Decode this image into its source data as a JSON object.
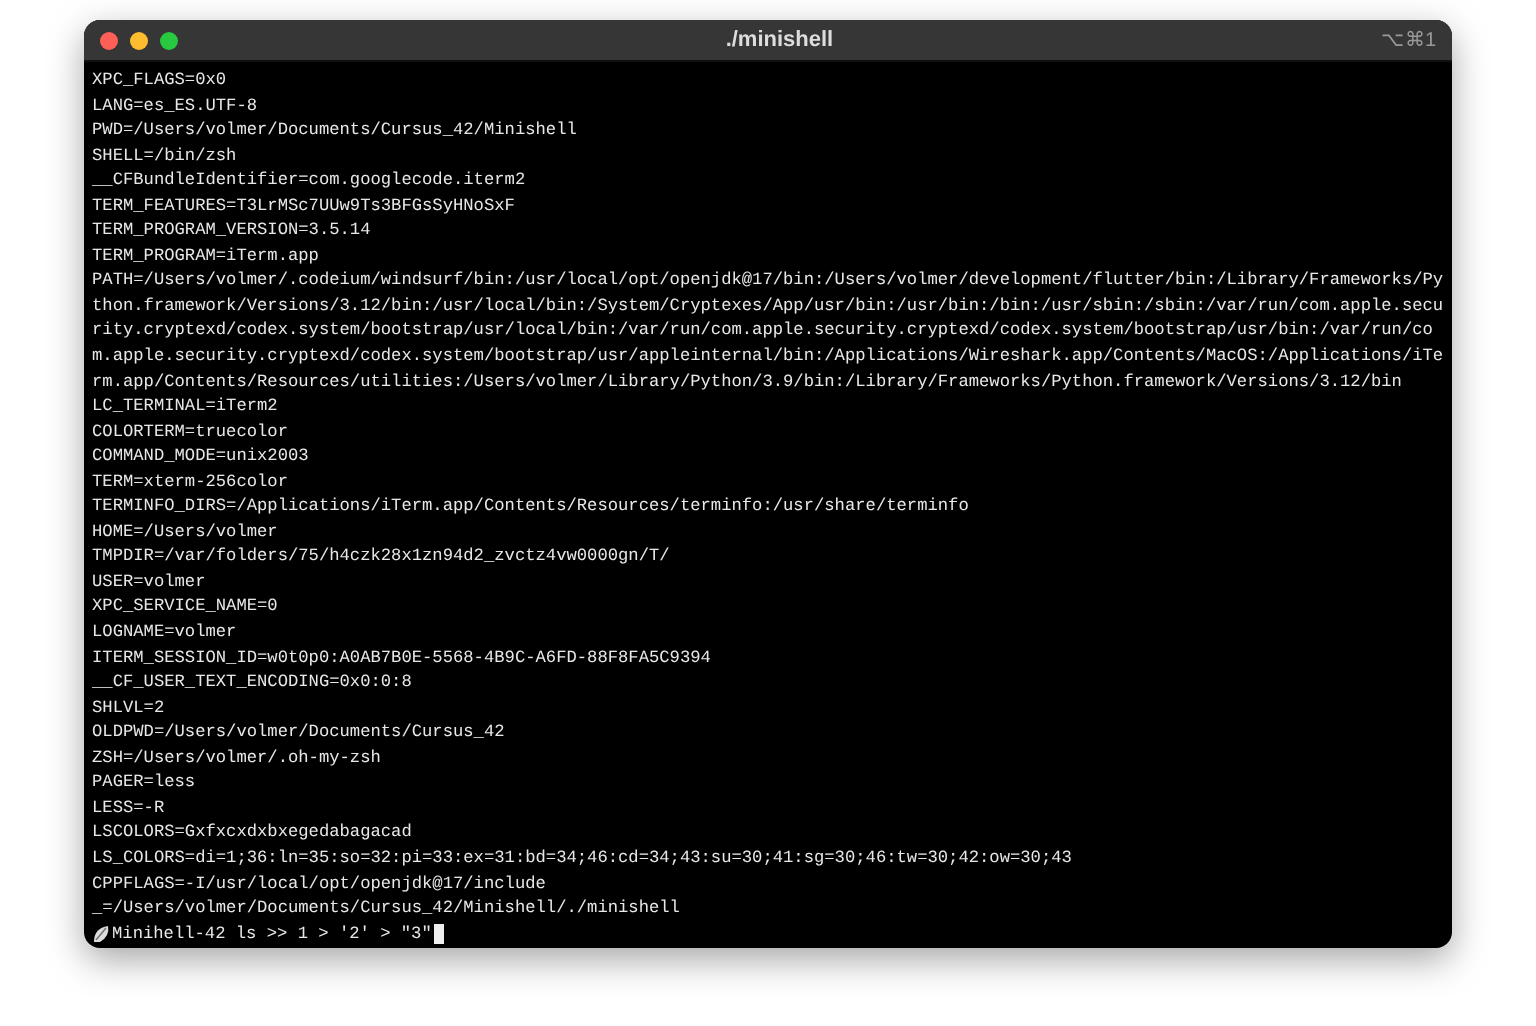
{
  "window": {
    "title": "./minishell",
    "shortcut": "⌥⌘1"
  },
  "terminal": {
    "lines": [
      "XPC_FLAGS=0x0",
      "LANG=es_ES.UTF-8",
      "PWD=/Users/volmer/Documents/Cursus_42/Minishell",
      "SHELL=/bin/zsh",
      "__CFBundleIdentifier=com.googlecode.iterm2",
      "TERM_FEATURES=T3LrMSc7UUw9Ts3BFGsSyHNoSxF",
      "TERM_PROGRAM_VERSION=3.5.14",
      "TERM_PROGRAM=iTerm.app",
      "PATH=/Users/volmer/.codeium/windsurf/bin:/usr/local/opt/openjdk@17/bin:/Users/volmer/development/flutter/bin:/Library/Frameworks/Python.framework/Versions/3.12/bin:/usr/local/bin:/System/Cryptexes/App/usr/bin:/usr/bin:/bin:/usr/sbin:/sbin:/var/run/com.apple.security.cryptexd/codex.system/bootstrap/usr/local/bin:/var/run/com.apple.security.cryptexd/codex.system/bootstrap/usr/bin:/var/run/com.apple.security.cryptexd/codex.system/bootstrap/usr/appleinternal/bin:/Applications/Wireshark.app/Contents/MacOS:/Applications/iTerm.app/Contents/Resources/utilities:/Users/volmer/Library/Python/3.9/bin:/Library/Frameworks/Python.framework/Versions/3.12/bin",
      "LC_TERMINAL=iTerm2",
      "COLORTERM=truecolor",
      "COMMAND_MODE=unix2003",
      "TERM=xterm-256color",
      "TERMINFO_DIRS=/Applications/iTerm.app/Contents/Resources/terminfo:/usr/share/terminfo",
      "HOME=/Users/volmer",
      "TMPDIR=/var/folders/75/h4czk28x1zn94d2_zvctz4vw0000gn/T/",
      "USER=volmer",
      "XPC_SERVICE_NAME=0",
      "LOGNAME=volmer",
      "ITERM_SESSION_ID=w0t0p0:A0AB7B0E-5568-4B9C-A6FD-88F8FA5C9394",
      "__CF_USER_TEXT_ENCODING=0x0:0:8",
      "SHLVL=2",
      "OLDPWD=/Users/volmer/Documents/Cursus_42",
      "ZSH=/Users/volmer/.oh-my-zsh",
      "PAGER=less",
      "LESS=-R",
      "LSCOLORS=Gxfxcxdxbxegedabagacad",
      "LS_COLORS=di=1;36:ln=35:so=32:pi=33:ex=31:bd=34;46:cd=34;43:su=30;41:sg=30;46:tw=30;42:ow=30;43",
      "CPPFLAGS=-I/usr/local/opt/openjdk@17/include",
      "_=/Users/volmer/Documents/Cursus_42/Minishell/./minishell"
    ],
    "prompt": {
      "name": "Minihell-42",
      "command": "ls >> 1 > '2' > \"3\""
    }
  }
}
